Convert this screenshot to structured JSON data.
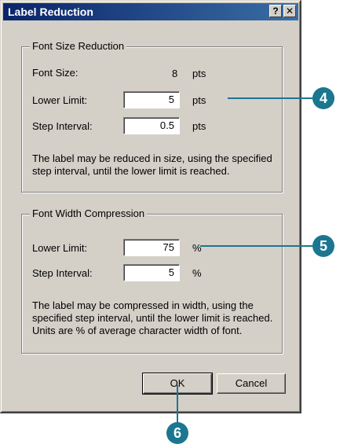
{
  "window": {
    "title": "Label Reduction",
    "help_label": "?",
    "close_label": "✕"
  },
  "font_size_reduction": {
    "legend": "Font Size Reduction",
    "font_size_label": "Font Size:",
    "font_size_value": "8",
    "font_size_unit": "pts",
    "lower_limit_label": "Lower Limit:",
    "lower_limit_value": "5",
    "lower_limit_unit": "pts",
    "step_interval_label": "Step Interval:",
    "step_interval_value": "0.5",
    "step_interval_unit": "pts",
    "note_line1": "The label may be reduced in size, using the specified",
    "note_line2": "step interval, until the lower limit is reached."
  },
  "font_width_compression": {
    "legend": "Font Width Compression",
    "lower_limit_label": "Lower Limit:",
    "lower_limit_value": "75",
    "lower_limit_unit": "%",
    "step_interval_label": "Step Interval:",
    "step_interval_value": "5",
    "step_interval_unit": "%",
    "note_line1": "The label may be compressed in width, using the",
    "note_line2": "specified step interval, until the lower limit is reached.",
    "note_line3": "Units are % of average character width of font."
  },
  "buttons": {
    "ok": "OK",
    "cancel": "Cancel"
  },
  "callouts": {
    "c4": "4",
    "c5": "5",
    "c6": "6"
  },
  "colors": {
    "title_bar": "#0a246a",
    "dialog_face": "#d4d0c8",
    "callout": "#1c7690"
  }
}
